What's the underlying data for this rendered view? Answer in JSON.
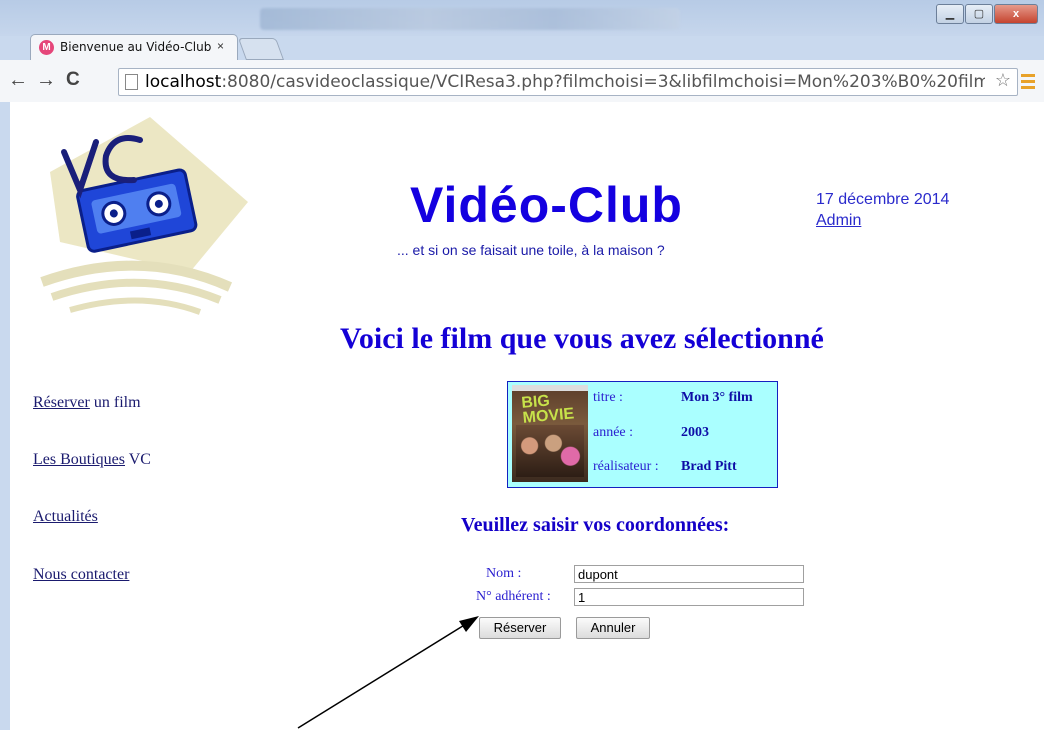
{
  "browser": {
    "tab_title": "Bienvenue au Vidéo-Club",
    "tab_close": "×",
    "address_host": "localhost",
    "address_rest": ":8080/casvideoclassique/VCIResa3.php?filmchoisi=3&libfilmchoisi=Mon%203%B0%20film&anfilmc",
    "back_icon": "←",
    "forward_icon": "→",
    "reload_icon": "C",
    "star_icon": "☆",
    "minimize_icon": "▁",
    "maximize_icon": "▢",
    "close_icon": "x"
  },
  "site": {
    "title": "Vidéo-Club",
    "tagline": "... et si on se faisait une toile, à la maison ?",
    "date": "17 décembre 2014",
    "admin_link": "Admin"
  },
  "sidebar": {
    "items": [
      {
        "link": "Réserver",
        "suffix": " un film"
      },
      {
        "link": "Les Boutiques",
        "suffix": " VC"
      },
      {
        "link": "Actualités",
        "suffix": ""
      },
      {
        "link": "Nous contacter",
        "suffix": ""
      }
    ]
  },
  "main": {
    "heading": "Voici le film que vous avez sélectionné",
    "film": {
      "poster_text": "BIG MOVIE",
      "rows": [
        {
          "label": "titre :",
          "value": "Mon 3° film"
        },
        {
          "label": "année :",
          "value": "2003"
        },
        {
          "label": "réalisateur :",
          "value": "Brad Pitt"
        }
      ]
    },
    "form_heading": "Veuillez saisir vos coordonnées:",
    "form": {
      "nom_label": "Nom :",
      "nom_value": "dupont",
      "adherent_label": "N° adhérent :",
      "adherent_value": "1",
      "submit_label": "Réserver",
      "cancel_label": "Annuler"
    }
  },
  "colors": {
    "brand_blue": "#1400e0",
    "film_box_bg": "#aaffff"
  }
}
